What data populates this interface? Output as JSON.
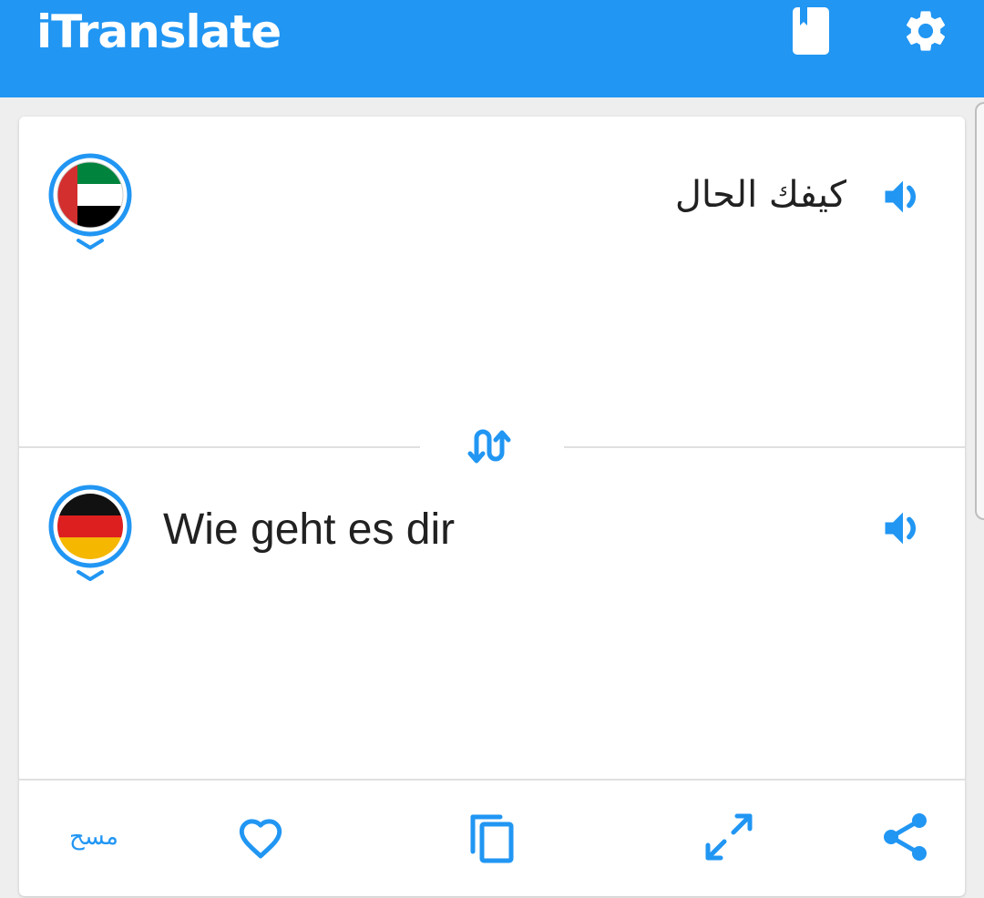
{
  "app": {
    "title": "iTranslate",
    "accent_color": "#2196f3",
    "icons": [
      "phrasebook-icon",
      "settings-gear-icon"
    ]
  },
  "source": {
    "language_flag": "uae-flag-icon",
    "text": "كيفك الحال",
    "speak_icon": "speaker-icon"
  },
  "swap": {
    "icon": "swap-languages-icon"
  },
  "target": {
    "language_flag": "germany-flag-icon",
    "text": "Wie geht es dir",
    "speak_icon": "speaker-icon"
  },
  "actions": {
    "clear_label": "مسح",
    "icons": [
      "heart-icon",
      "copy-icon",
      "fullscreen-icon",
      "share-icon"
    ]
  }
}
